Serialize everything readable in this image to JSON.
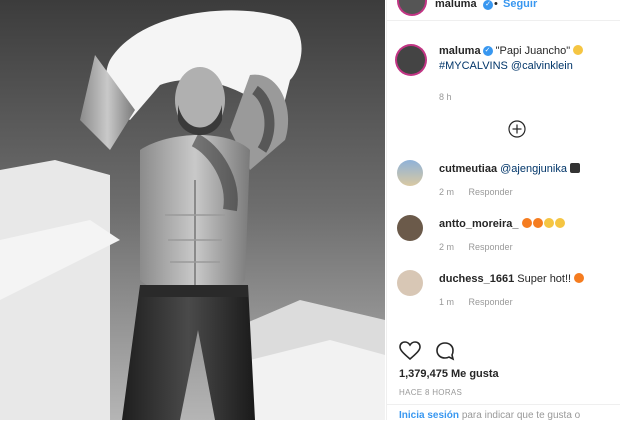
{
  "post": {
    "author": "maluma",
    "follow_label": "Seguir",
    "caption_quote": "\"Papi Juancho\"",
    "caption_tags": "#MYCALVINS @calvinklein",
    "age": "8 h",
    "likes": "1,379,475",
    "likes_label": "Me gusta",
    "time_ago": "HACE 8 HORAS",
    "login_link": "Inicia sesión",
    "login_rest": "para indicar que te gusta o"
  },
  "comments": [
    {
      "user": "cutmeutiaa",
      "text": "@ajengjunika",
      "age": "2 m",
      "reply": "Responder"
    },
    {
      "user": "antto_moreira_",
      "text": "",
      "age": "2 m",
      "reply": "Responder"
    },
    {
      "user": "duchess_1661",
      "text": "Super hot!!",
      "age": "1 m",
      "reply": "Responder"
    }
  ],
  "icons": {
    "verified": "verified-badge-icon",
    "load_more": "plus-circle-icon",
    "like": "heart-icon",
    "comment": "comment-icon"
  },
  "colors": {
    "link_blue": "#3897f0",
    "hashtag": "#003569",
    "muted": "#999999"
  }
}
